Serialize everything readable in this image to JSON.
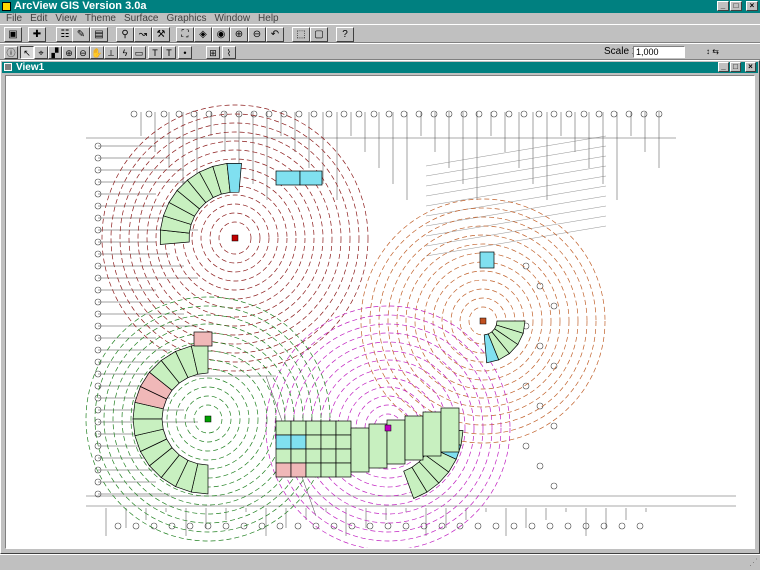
{
  "app": {
    "title": "ArcView GIS Version 3.0a"
  },
  "window_controls": {
    "minimize": "_",
    "maximize": "□",
    "close": "×"
  },
  "menu": [
    {
      "label": "File"
    },
    {
      "label": "Edit"
    },
    {
      "label": "View"
    },
    {
      "label": "Theme"
    },
    {
      "label": "Surface"
    },
    {
      "label": "Graphics"
    },
    {
      "label": "Window"
    },
    {
      "label": "Help"
    }
  ],
  "toolbar1": {
    "buttons": [
      {
        "name": "save-project-button",
        "icon": "floppy-icon",
        "glyph": "▣"
      },
      {
        "name": "add-theme-button",
        "icon": "plus-icon",
        "glyph": "✚"
      },
      {
        "name": "theme-properties-button",
        "icon": "properties-icon",
        "glyph": "☷"
      },
      {
        "name": "edit-legend-button",
        "icon": "legend-icon",
        "glyph": "✎"
      },
      {
        "name": "open-table-button",
        "icon": "table-icon",
        "glyph": "▤"
      },
      {
        "name": "find-button",
        "icon": "binoculars-icon",
        "glyph": "⚲"
      },
      {
        "name": "locate-address-button",
        "icon": "locate-icon",
        "glyph": "↝"
      },
      {
        "name": "query-builder-button",
        "icon": "hammer-icon",
        "glyph": "⚒"
      },
      {
        "name": "zoom-full-extent-button",
        "icon": "full-extent-icon",
        "glyph": "⛶"
      },
      {
        "name": "zoom-active-themes-button",
        "icon": "zoom-active-icon",
        "glyph": "◈"
      },
      {
        "name": "zoom-selected-button",
        "icon": "zoom-selected-icon",
        "glyph": "◉"
      },
      {
        "name": "zoom-in-button",
        "icon": "zoom-in-icon",
        "glyph": "⊕"
      },
      {
        "name": "zoom-out-button",
        "icon": "zoom-out-icon",
        "glyph": "⊖"
      },
      {
        "name": "zoom-previous-button",
        "icon": "zoom-previous-icon",
        "glyph": "↶"
      },
      {
        "name": "select-features-button",
        "icon": "select-features-icon",
        "glyph": "⬚"
      },
      {
        "name": "clear-selection-button",
        "icon": "clear-selection-icon",
        "glyph": "▢"
      },
      {
        "name": "help-button",
        "icon": "help-icon",
        "glyph": "?"
      }
    ]
  },
  "toolbar2": {
    "tools": [
      {
        "name": "identify-tool",
        "icon": "info-icon",
        "glyph": "ⓘ",
        "pressed": false
      },
      {
        "name": "pointer-tool",
        "icon": "arrow-icon",
        "glyph": "↖",
        "pressed": true
      },
      {
        "name": "vertex-edit-tool",
        "icon": "vertex-icon",
        "glyph": "⌖",
        "pressed": false
      },
      {
        "name": "select-feature-tool",
        "icon": "select-icon",
        "glyph": "▞",
        "pressed": false
      },
      {
        "name": "zoom-in-tool",
        "icon": "magnifier-plus-icon",
        "glyph": "⊕",
        "pressed": false
      },
      {
        "name": "zoom-out-tool",
        "icon": "magnifier-minus-icon",
        "glyph": "⊖",
        "pressed": false
      },
      {
        "name": "pan-tool",
        "icon": "hand-icon",
        "glyph": "✋",
        "pressed": false
      },
      {
        "name": "measure-tool",
        "icon": "ruler-icon",
        "glyph": "⟂",
        "pressed": false
      },
      {
        "name": "hot-link-tool",
        "icon": "lightning-icon",
        "glyph": "ϟ",
        "pressed": false
      },
      {
        "name": "area-of-interest-tool",
        "icon": "rectangle-icon",
        "glyph": "▭",
        "pressed": false
      },
      {
        "name": "label-tool",
        "icon": "label-icon",
        "glyph": "T",
        "pressed": false
      },
      {
        "name": "text-tool",
        "icon": "text-icon",
        "glyph": "T",
        "pressed": false
      },
      {
        "name": "draw-point-tool",
        "icon": "point-icon",
        "glyph": "•",
        "pressed": false
      },
      {
        "name": "snap-tool",
        "icon": "snap-icon",
        "glyph": "⊞",
        "pressed": false
      },
      {
        "name": "contour-tool",
        "icon": "contour-icon",
        "glyph": "⌇",
        "pressed": false
      }
    ],
    "scale_label": "Scale 1:",
    "scale_value": "1,000",
    "coord_readout": "↕ ⇆"
  },
  "view": {
    "title": "View1"
  },
  "status": {
    "text": ""
  },
  "colors": {
    "titlebar": "#008080",
    "face": "#c0c0c0",
    "ring_red": "#8b1a1a",
    "ring_orange": "#c0602a",
    "ring_magenta": "#c020c0",
    "ring_green": "#208020",
    "building_fill": "#c8f0c0",
    "highlight_cyan": "#80e0f0",
    "highlight_pink": "#f0b8b8"
  },
  "map": {
    "centers": [
      {
        "name": "red-center",
        "color": "#c00000"
      },
      {
        "name": "orange-center",
        "color": "#c05020"
      },
      {
        "name": "magenta-center",
        "color": "#c000c0"
      },
      {
        "name": "green-center",
        "color": "#00a000"
      }
    ]
  }
}
